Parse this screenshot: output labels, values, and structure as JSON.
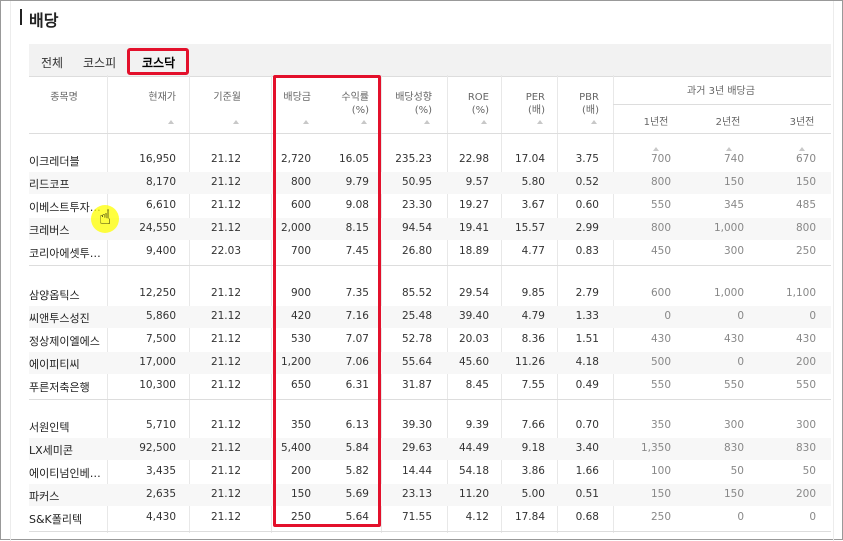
{
  "title": "배당",
  "tabs": [
    {
      "label": "전체",
      "active": false
    },
    {
      "label": "코스피",
      "active": false
    },
    {
      "label": "코스닥",
      "active": true
    }
  ],
  "headers": {
    "name": "종목명",
    "price": "현재가",
    "base_month": "기준월",
    "dividend": "배당금",
    "yield": "수익률",
    "yield_unit": "(%)",
    "payout": "배당성향",
    "payout_unit": "(%)",
    "roe": "ROE",
    "roe_unit": "(%)",
    "per": "PER",
    "per_unit": "(배)",
    "pbr": "PBR",
    "pbr_unit": "(배)",
    "past_group": "과거 3년 배당금",
    "y1": "1년전",
    "y2": "2년전",
    "y3": "3년전"
  },
  "rows": [
    {
      "name": "이크레더블",
      "price": "16,950",
      "base": "21.12",
      "div": "2,720",
      "yield": "16.05",
      "payout": "235.23",
      "roe": "22.98",
      "per": "17.04",
      "pbr": "3.75",
      "y1": "700",
      "y2": "740",
      "y3": "670"
    },
    {
      "name": "리드코프",
      "price": "8,170",
      "base": "21.12",
      "div": "800",
      "yield": "9.79",
      "payout": "50.95",
      "roe": "9.57",
      "per": "5.80",
      "pbr": "0.52",
      "y1": "800",
      "y2": "150",
      "y3": "150"
    },
    {
      "name": "이베스트투자…",
      "price": "6,610",
      "base": "21.12",
      "div": "600",
      "yield": "9.08",
      "payout": "23.30",
      "roe": "19.27",
      "per": "3.67",
      "pbr": "0.60",
      "y1": "550",
      "y2": "345",
      "y3": "485"
    },
    {
      "name": "크레버스",
      "price": "24,550",
      "base": "21.12",
      "div": "2,000",
      "yield": "8.15",
      "payout": "94.54",
      "roe": "19.41",
      "per": "15.57",
      "pbr": "2.99",
      "y1": "800",
      "y2": "1,000",
      "y3": "800"
    },
    {
      "name": "코리아에셋투…",
      "price": "9,400",
      "base": "22.03",
      "div": "700",
      "yield": "7.45",
      "payout": "26.80",
      "roe": "18.89",
      "per": "4.77",
      "pbr": "0.83",
      "y1": "450",
      "y2": "300",
      "y3": "250"
    },
    {
      "name": "삼양옵틱스",
      "price": "12,250",
      "base": "21.12",
      "div": "900",
      "yield": "7.35",
      "payout": "85.52",
      "roe": "29.54",
      "per": "9.85",
      "pbr": "2.79",
      "y1": "600",
      "y2": "1,000",
      "y3": "1,100"
    },
    {
      "name": "씨앤투스성진",
      "price": "5,860",
      "base": "21.12",
      "div": "420",
      "yield": "7.16",
      "payout": "25.48",
      "roe": "39.40",
      "per": "4.79",
      "pbr": "1.33",
      "y1": "0",
      "y2": "0",
      "y3": "0"
    },
    {
      "name": "정상제이엘에스",
      "price": "7,500",
      "base": "21.12",
      "div": "530",
      "yield": "7.07",
      "payout": "52.78",
      "roe": "20.03",
      "per": "8.36",
      "pbr": "1.51",
      "y1": "430",
      "y2": "430",
      "y3": "430"
    },
    {
      "name": "에이피티씨",
      "price": "17,000",
      "base": "21.12",
      "div": "1,200",
      "yield": "7.06",
      "payout": "55.64",
      "roe": "45.60",
      "per": "11.26",
      "pbr": "4.18",
      "y1": "500",
      "y2": "0",
      "y3": "200"
    },
    {
      "name": "푸른저축은행",
      "price": "10,300",
      "base": "21.12",
      "div": "650",
      "yield": "6.31",
      "payout": "31.87",
      "roe": "8.45",
      "per": "7.55",
      "pbr": "0.49",
      "y1": "550",
      "y2": "550",
      "y3": "550"
    },
    {
      "name": "서원인텍",
      "price": "5,710",
      "base": "21.12",
      "div": "350",
      "yield": "6.13",
      "payout": "39.30",
      "roe": "9.39",
      "per": "7.66",
      "pbr": "0.70",
      "y1": "350",
      "y2": "300",
      "y3": "300"
    },
    {
      "name": "LX세미콘",
      "price": "92,500",
      "base": "21.12",
      "div": "5,400",
      "yield": "5.84",
      "payout": "29.63",
      "roe": "44.49",
      "per": "9.18",
      "pbr": "3.40",
      "y1": "1,350",
      "y2": "830",
      "y3": "830"
    },
    {
      "name": "에이티넘인베…",
      "price": "3,435",
      "base": "21.12",
      "div": "200",
      "yield": "5.82",
      "payout": "14.44",
      "roe": "54.18",
      "per": "3.86",
      "pbr": "1.66",
      "y1": "100",
      "y2": "50",
      "y3": "50"
    },
    {
      "name": "파커스",
      "price": "2,635",
      "base": "21.12",
      "div": "150",
      "yield": "5.69",
      "payout": "23.13",
      "roe": "11.20",
      "per": "5.00",
      "pbr": "0.51",
      "y1": "150",
      "y2": "150",
      "y3": "200"
    },
    {
      "name": "S&K폴리텍",
      "price": "4,430",
      "base": "21.12",
      "div": "250",
      "yield": "5.64",
      "payout": "71.55",
      "roe": "4.12",
      "per": "17.84",
      "pbr": "0.68",
      "y1": "250",
      "y2": "0",
      "y3": "0"
    }
  ]
}
